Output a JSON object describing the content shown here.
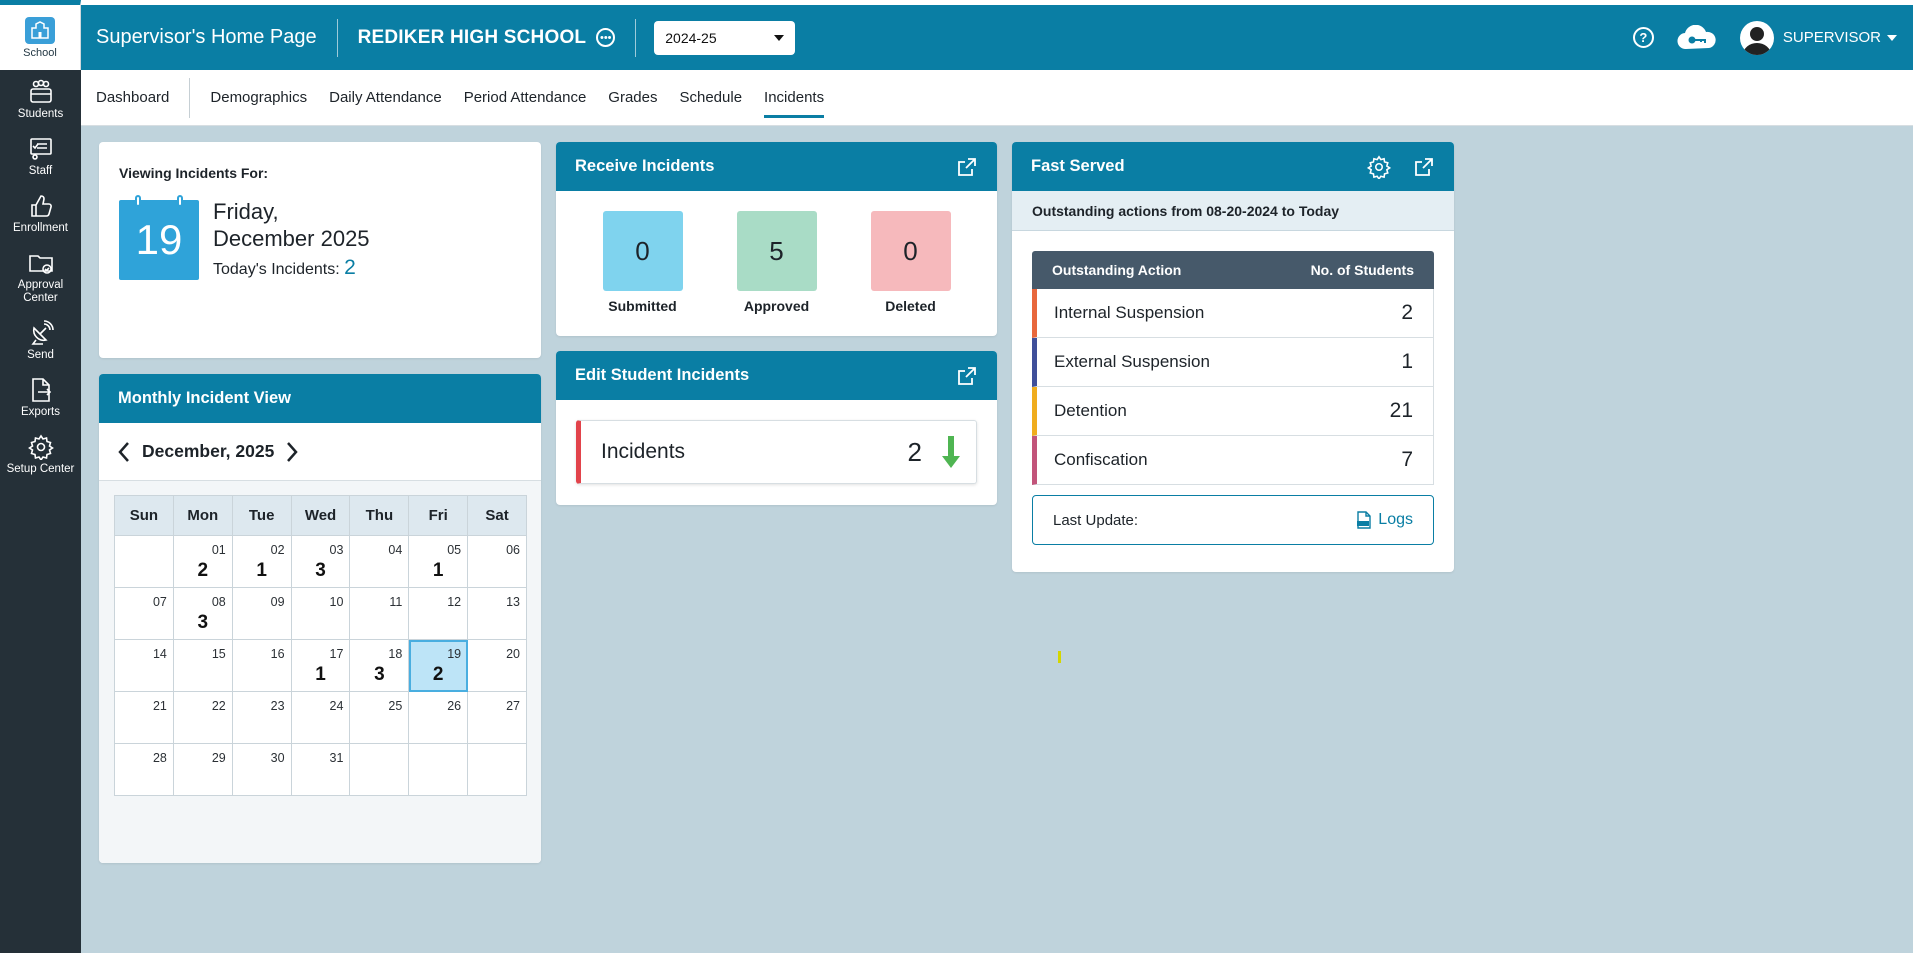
{
  "sidebar": {
    "top": {
      "label": "School"
    },
    "items": [
      {
        "label": "Students",
        "icon": "students-icon"
      },
      {
        "label": "Staff",
        "icon": "staff-icon"
      },
      {
        "label": "Enrollment",
        "icon": "thumbs-up-icon"
      },
      {
        "label": "Approval Center",
        "icon": "folder-check-icon"
      },
      {
        "label": "Send",
        "icon": "satellite-icon"
      },
      {
        "label": "Exports",
        "icon": "file-export-icon"
      },
      {
        "label": "Setup Center",
        "icon": "gear-icon"
      }
    ]
  },
  "header": {
    "title": "Supervisor's Home Page",
    "school": "REDIKER HIGH SCHOOL",
    "year": "2024-25",
    "user": "SUPERVISOR"
  },
  "tabs": [
    "Dashboard",
    "Demographics",
    "Daily Attendance",
    "Period Attendance",
    "Grades",
    "Schedule",
    "Incidents"
  ],
  "active_tab": "Incidents",
  "viewing": {
    "label": "Viewing Incidents For:",
    "day_number": "19",
    "weekday": "Friday,",
    "month_year": "December 2025",
    "today_label": "Today's Incidents:",
    "today_count": "2"
  },
  "receive": {
    "title": "Receive Incidents",
    "items": [
      {
        "value": "0",
        "label": "Submitted",
        "color": "#7fd3ee"
      },
      {
        "value": "5",
        "label": "Approved",
        "color": "#a9dcc6"
      },
      {
        "value": "0",
        "label": "Deleted",
        "color": "#f6b9bc"
      }
    ]
  },
  "edit": {
    "title": "Edit Student Incidents",
    "row_label": "Incidents",
    "row_value": "2"
  },
  "fast_served": {
    "title": "Fast Served",
    "subtitle": "Outstanding actions from 08-20-2024 to Today",
    "col_action": "Outstanding Action",
    "col_students": "No. of Students",
    "rows": [
      {
        "name": "Internal Suspension",
        "value": "2",
        "color": "#e8673c"
      },
      {
        "name": "External Suspension",
        "value": "1",
        "color": "#3f4f9a"
      },
      {
        "name": "Detention",
        "value": "21",
        "color": "#f0ad1e"
      },
      {
        "name": "Confiscation",
        "value": "7",
        "color": "#c2547a"
      }
    ],
    "last_update_label": "Last Update:",
    "logs_label": "Logs"
  },
  "monthly": {
    "title": "Monthly Incident View",
    "month_label": "December, 2025",
    "weekdays": [
      "Sun",
      "Mon",
      "Tue",
      "Wed",
      "Thu",
      "Fri",
      "Sat"
    ],
    "weeks": [
      [
        {
          "d": ""
        },
        {
          "d": "01",
          "c": "2"
        },
        {
          "d": "02",
          "c": "1"
        },
        {
          "d": "03",
          "c": "3"
        },
        {
          "d": "04"
        },
        {
          "d": "05",
          "c": "1"
        },
        {
          "d": "06"
        }
      ],
      [
        {
          "d": "07"
        },
        {
          "d": "08",
          "c": "3"
        },
        {
          "d": "09"
        },
        {
          "d": "10"
        },
        {
          "d": "11"
        },
        {
          "d": "12"
        },
        {
          "d": "13"
        }
      ],
      [
        {
          "d": "14"
        },
        {
          "d": "15"
        },
        {
          "d": "16"
        },
        {
          "d": "17",
          "c": "1"
        },
        {
          "d": "18",
          "c": "3"
        },
        {
          "d": "19",
          "c": "2",
          "selected": true
        },
        {
          "d": "20"
        }
      ],
      [
        {
          "d": "21"
        },
        {
          "d": "22"
        },
        {
          "d": "23"
        },
        {
          "d": "24"
        },
        {
          "d": "25"
        },
        {
          "d": "26"
        },
        {
          "d": "27"
        }
      ],
      [
        {
          "d": "28"
        },
        {
          "d": "29"
        },
        {
          "d": "30"
        },
        {
          "d": "31"
        },
        {
          "d": ""
        },
        {
          "d": ""
        },
        {
          "d": ""
        }
      ]
    ]
  }
}
